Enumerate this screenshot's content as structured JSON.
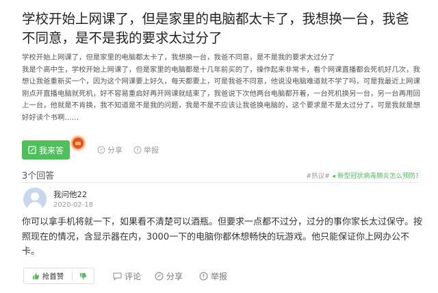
{
  "question": {
    "title": "学校开始上网课了，但是家里的电脑都太卡了，我想换一台，我爸不同意，是不是我的要求太过分了",
    "body_lines": [
      "学校开始上网课了，但是家里的电脑都太卡了，我想换一台，我爸不同意，是不是我的要求太过分了",
      "我是个高中生，学校开始上网课了，但是家里的电脑都是十几年前买的了，操作起来非常卡，看个网课直播都会死机好几次，我想让我爸重新买一个，因为这个网课要上好久，每天都要上，可是我爸不同意，他说没电脑难道就不学了吗，可是我最近上网课刚点开直播电脑就死机，好不容易重启好再开网课就结束了，我爸说下次他两台电脑都开着，一台死机换另一台，另一台再用回上一台，他就是不肯换，我不知道是不是我的问题，我是不是不应该让我爸换电脑的，这个要求是不是太过分了，可是我就是想好好读个书啊……"
    ],
    "actions": {
      "answer_label": "我来答",
      "share_label": "分享",
      "report_label": "举报"
    }
  },
  "answers_header": {
    "count_label": "3个回答",
    "hot_prefix": "#热议#",
    "hot_link": "新型冠状病毒肺炎怎么预防?"
  },
  "answer": {
    "user_name": "我问他22",
    "date": "2020-02-18",
    "text": "你可以拿手机将就一下，如果看不清楚可以酒瓶。但要求一点都不过分，过分的事你家长太过保守。按照现在的情况，含显示器在内，3000一下的电脑你都休想畅快的玩游戏。他只能保证你上网办公不卡。",
    "actions": {
      "upvote_label": "抢首赞",
      "comment_label": "评论",
      "share_label": "分享",
      "report_label": "举报"
    }
  },
  "colors": {
    "accent_green": "#4fbf5c",
    "text_dark": "#222222",
    "text_muted": "#999999"
  },
  "icons": [
    "edit-icon",
    "redpacket-icon",
    "share-icon",
    "report-icon",
    "avatar-icon",
    "thumb-up-icon",
    "thumb-down-icon",
    "comment-icon"
  ]
}
